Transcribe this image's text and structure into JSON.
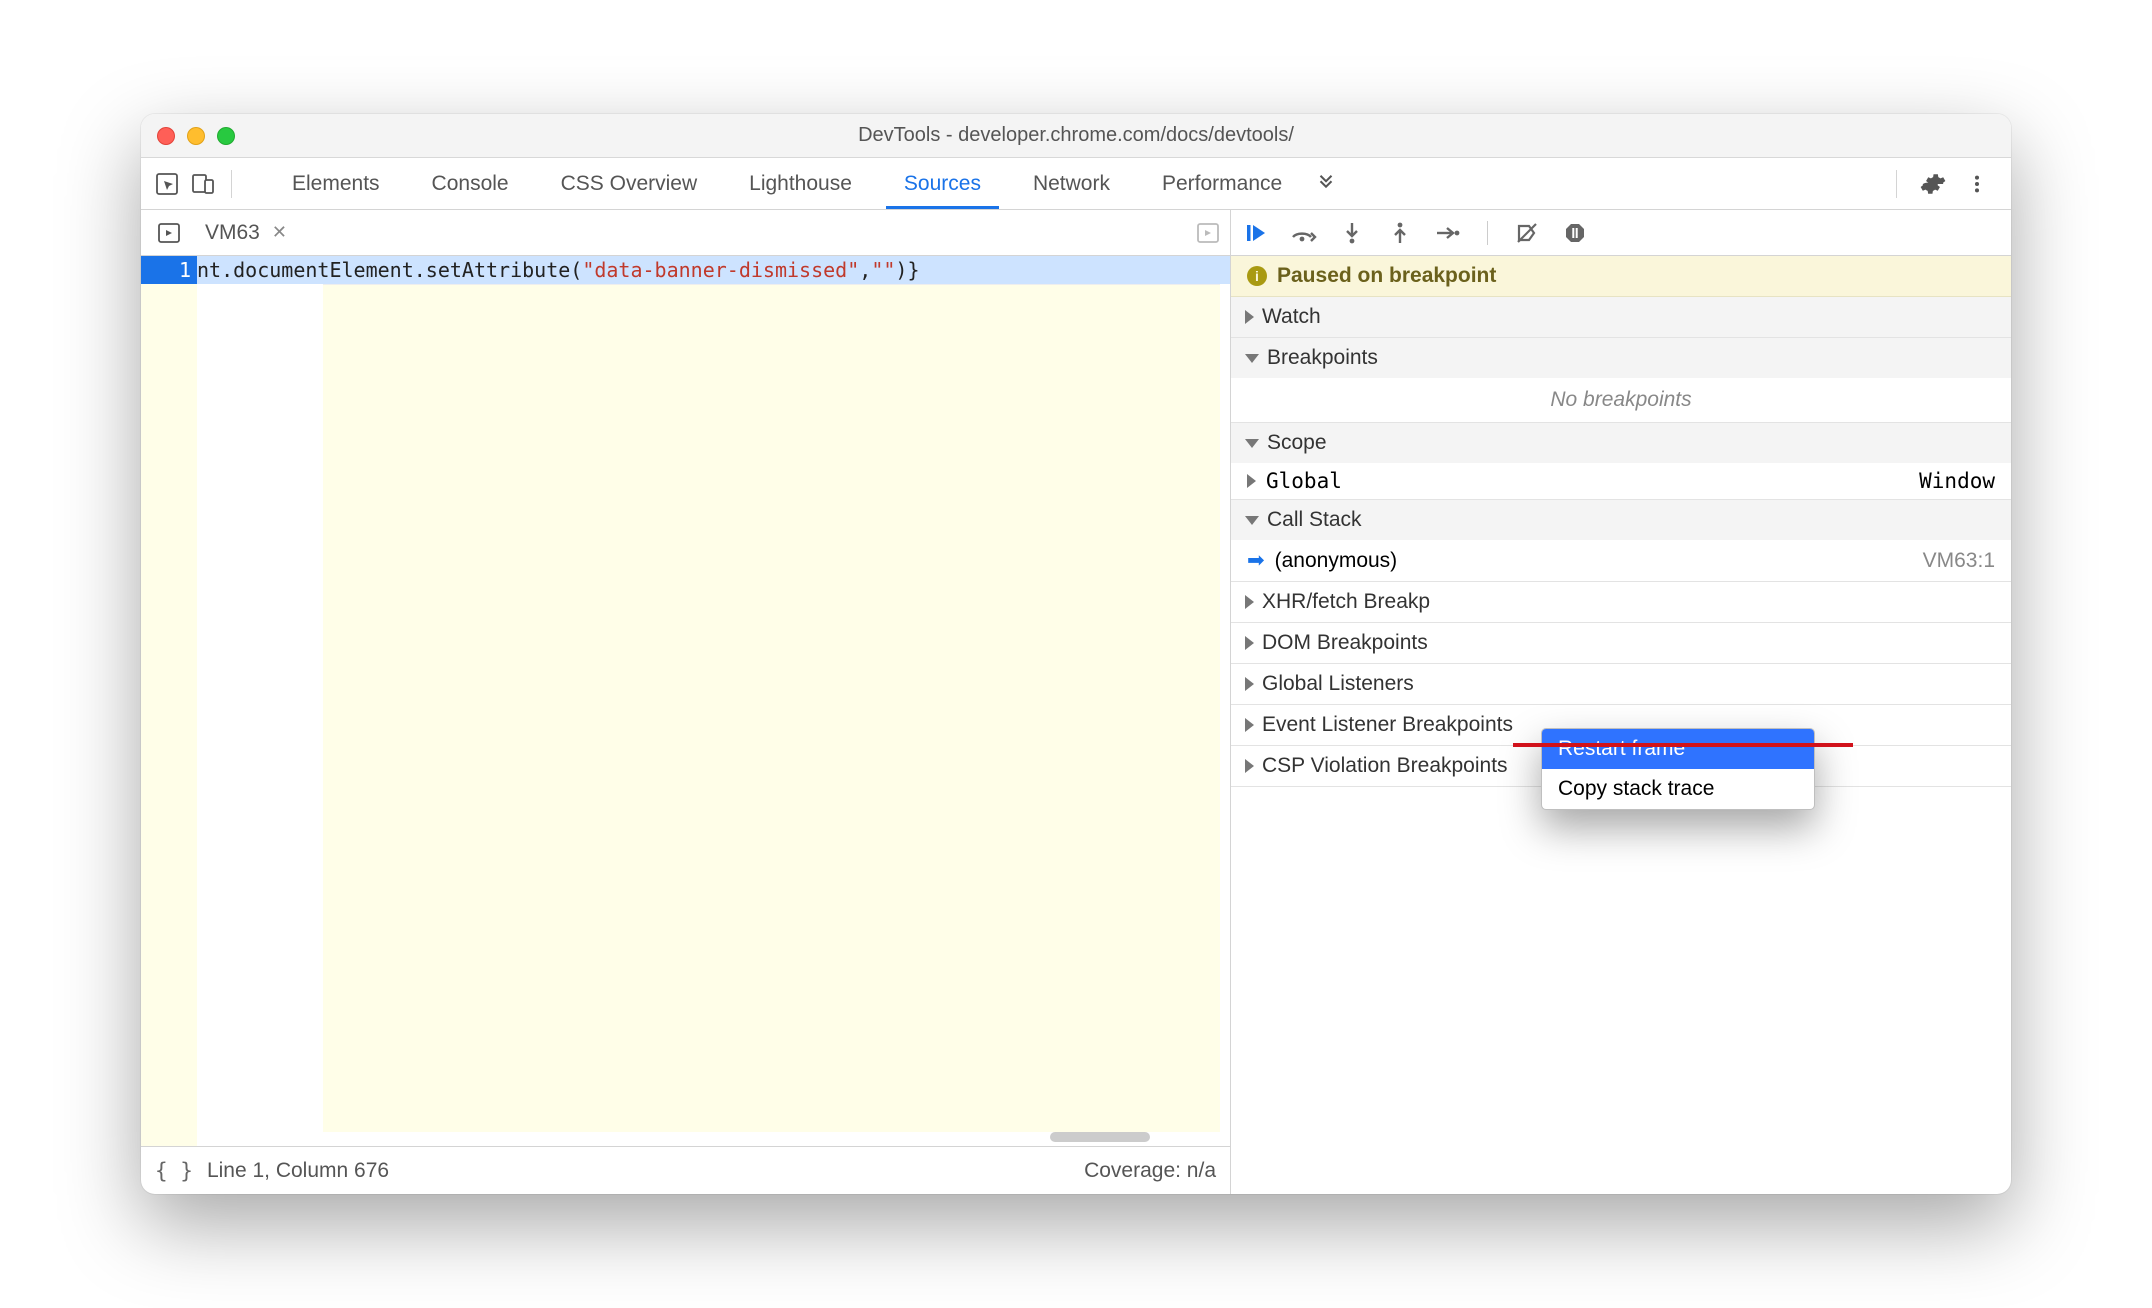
{
  "window": {
    "title": "DevTools - developer.chrome.com/docs/devtools/"
  },
  "tabs": {
    "items": [
      "Elements",
      "Console",
      "CSS Overview",
      "Lighthouse",
      "Sources",
      "Network",
      "Performance"
    ],
    "active": "Sources"
  },
  "editor": {
    "file_tab": "VM63",
    "gutter_line": "1",
    "code_prefix": "nt.documentElement.setAttribute(",
    "code_string": "\"data-banner-dismissed\"",
    "code_mid": ",",
    "code_string2": "\"\"",
    "code_suffix": ")}"
  },
  "statusbar": {
    "position": "Line 1, Column 676",
    "coverage": "Coverage: n/a"
  },
  "debug": {
    "paused_text": "Paused on breakpoint",
    "sections": {
      "watch": "Watch",
      "breakpoints": "Breakpoints",
      "no_breakpoints": "No breakpoints",
      "scope": "Scope",
      "global": "Global",
      "global_obj": "Window",
      "callstack": "Call Stack",
      "frame_name": "(anonymous)",
      "frame_loc": "VM63:1",
      "xhr": "XHR/fetch Breakp",
      "dom": "DOM Breakpoints",
      "global_listeners": "Global Listeners",
      "event_listener": "Event Listener Breakpoints",
      "csp": "CSP Violation Breakpoints"
    }
  },
  "context_menu": {
    "item1": "Restart frame",
    "item2": "Copy stack trace"
  }
}
